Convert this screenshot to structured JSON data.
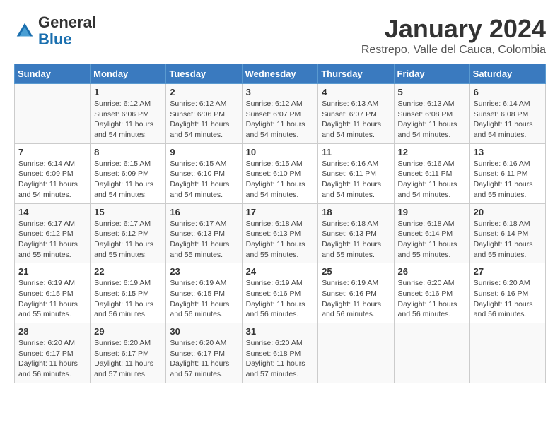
{
  "header": {
    "logo_general": "General",
    "logo_blue": "Blue",
    "title": "January 2024",
    "subtitle": "Restrepo, Valle del Cauca, Colombia"
  },
  "weekdays": [
    "Sunday",
    "Monday",
    "Tuesday",
    "Wednesday",
    "Thursday",
    "Friday",
    "Saturday"
  ],
  "weeks": [
    [
      {
        "day": "",
        "info": ""
      },
      {
        "day": "1",
        "info": "Sunrise: 6:12 AM\nSunset: 6:06 PM\nDaylight: 11 hours\nand 54 minutes."
      },
      {
        "day": "2",
        "info": "Sunrise: 6:12 AM\nSunset: 6:06 PM\nDaylight: 11 hours\nand 54 minutes."
      },
      {
        "day": "3",
        "info": "Sunrise: 6:12 AM\nSunset: 6:07 PM\nDaylight: 11 hours\nand 54 minutes."
      },
      {
        "day": "4",
        "info": "Sunrise: 6:13 AM\nSunset: 6:07 PM\nDaylight: 11 hours\nand 54 minutes."
      },
      {
        "day": "5",
        "info": "Sunrise: 6:13 AM\nSunset: 6:08 PM\nDaylight: 11 hours\nand 54 minutes."
      },
      {
        "day": "6",
        "info": "Sunrise: 6:14 AM\nSunset: 6:08 PM\nDaylight: 11 hours\nand 54 minutes."
      }
    ],
    [
      {
        "day": "7",
        "info": "Sunrise: 6:14 AM\nSunset: 6:09 PM\nDaylight: 11 hours\nand 54 minutes."
      },
      {
        "day": "8",
        "info": "Sunrise: 6:15 AM\nSunset: 6:09 PM\nDaylight: 11 hours\nand 54 minutes."
      },
      {
        "day": "9",
        "info": "Sunrise: 6:15 AM\nSunset: 6:10 PM\nDaylight: 11 hours\nand 54 minutes."
      },
      {
        "day": "10",
        "info": "Sunrise: 6:15 AM\nSunset: 6:10 PM\nDaylight: 11 hours\nand 54 minutes."
      },
      {
        "day": "11",
        "info": "Sunrise: 6:16 AM\nSunset: 6:11 PM\nDaylight: 11 hours\nand 54 minutes."
      },
      {
        "day": "12",
        "info": "Sunrise: 6:16 AM\nSunset: 6:11 PM\nDaylight: 11 hours\nand 54 minutes."
      },
      {
        "day": "13",
        "info": "Sunrise: 6:16 AM\nSunset: 6:11 PM\nDaylight: 11 hours\nand 55 minutes."
      }
    ],
    [
      {
        "day": "14",
        "info": "Sunrise: 6:17 AM\nSunset: 6:12 PM\nDaylight: 11 hours\nand 55 minutes."
      },
      {
        "day": "15",
        "info": "Sunrise: 6:17 AM\nSunset: 6:12 PM\nDaylight: 11 hours\nand 55 minutes."
      },
      {
        "day": "16",
        "info": "Sunrise: 6:17 AM\nSunset: 6:13 PM\nDaylight: 11 hours\nand 55 minutes."
      },
      {
        "day": "17",
        "info": "Sunrise: 6:18 AM\nSunset: 6:13 PM\nDaylight: 11 hours\nand 55 minutes."
      },
      {
        "day": "18",
        "info": "Sunrise: 6:18 AM\nSunset: 6:13 PM\nDaylight: 11 hours\nand 55 minutes."
      },
      {
        "day": "19",
        "info": "Sunrise: 6:18 AM\nSunset: 6:14 PM\nDaylight: 11 hours\nand 55 minutes."
      },
      {
        "day": "20",
        "info": "Sunrise: 6:18 AM\nSunset: 6:14 PM\nDaylight: 11 hours\nand 55 minutes."
      }
    ],
    [
      {
        "day": "21",
        "info": "Sunrise: 6:19 AM\nSunset: 6:15 PM\nDaylight: 11 hours\nand 55 minutes."
      },
      {
        "day": "22",
        "info": "Sunrise: 6:19 AM\nSunset: 6:15 PM\nDaylight: 11 hours\nand 56 minutes."
      },
      {
        "day": "23",
        "info": "Sunrise: 6:19 AM\nSunset: 6:15 PM\nDaylight: 11 hours\nand 56 minutes."
      },
      {
        "day": "24",
        "info": "Sunrise: 6:19 AM\nSunset: 6:16 PM\nDaylight: 11 hours\nand 56 minutes."
      },
      {
        "day": "25",
        "info": "Sunrise: 6:19 AM\nSunset: 6:16 PM\nDaylight: 11 hours\nand 56 minutes."
      },
      {
        "day": "26",
        "info": "Sunrise: 6:20 AM\nSunset: 6:16 PM\nDaylight: 11 hours\nand 56 minutes."
      },
      {
        "day": "27",
        "info": "Sunrise: 6:20 AM\nSunset: 6:16 PM\nDaylight: 11 hours\nand 56 minutes."
      }
    ],
    [
      {
        "day": "28",
        "info": "Sunrise: 6:20 AM\nSunset: 6:17 PM\nDaylight: 11 hours\nand 56 minutes."
      },
      {
        "day": "29",
        "info": "Sunrise: 6:20 AM\nSunset: 6:17 PM\nDaylight: 11 hours\nand 57 minutes."
      },
      {
        "day": "30",
        "info": "Sunrise: 6:20 AM\nSunset: 6:17 PM\nDaylight: 11 hours\nand 57 minutes."
      },
      {
        "day": "31",
        "info": "Sunrise: 6:20 AM\nSunset: 6:18 PM\nDaylight: 11 hours\nand 57 minutes."
      },
      {
        "day": "",
        "info": ""
      },
      {
        "day": "",
        "info": ""
      },
      {
        "day": "",
        "info": ""
      }
    ]
  ]
}
